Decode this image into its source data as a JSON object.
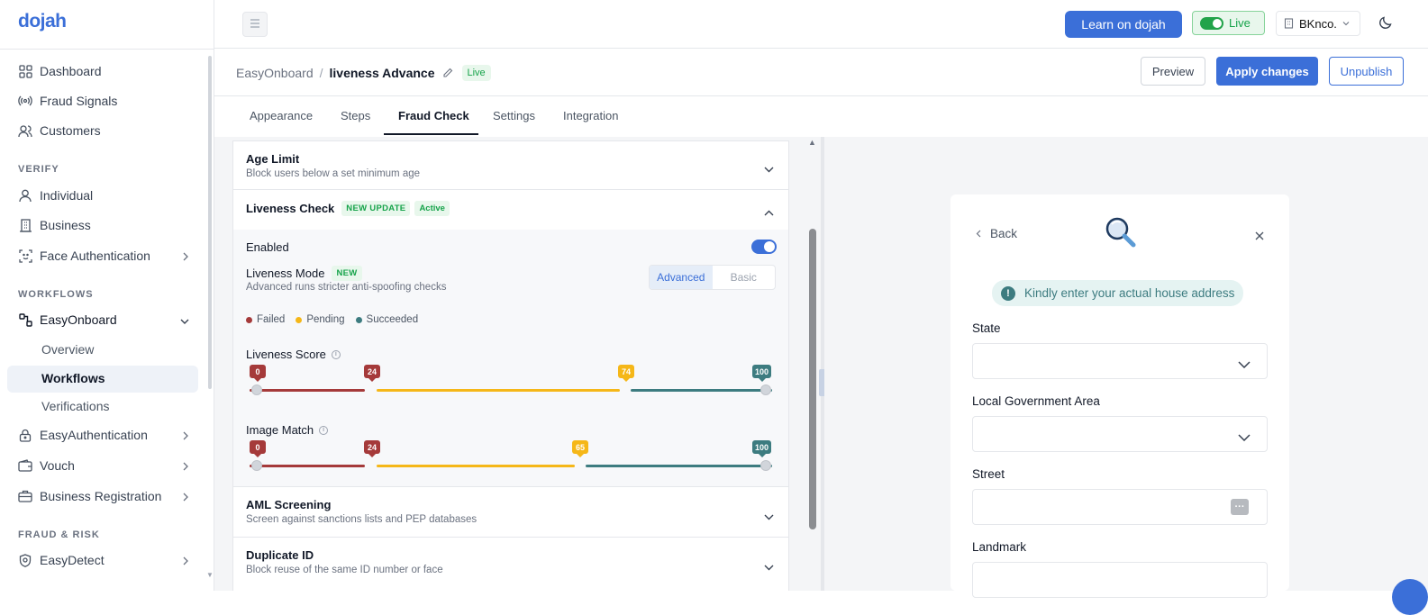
{
  "app": {
    "logo": "dojah"
  },
  "sidebar": {
    "items_top": [
      {
        "label": "Dashboard",
        "icon": "grid-icon"
      },
      {
        "label": "Fraud Signals",
        "icon": "signal-icon"
      },
      {
        "label": "Customers",
        "icon": "users-icon"
      }
    ],
    "section_verify": "VERIFY",
    "items_verify": [
      {
        "label": "Individual",
        "icon": "user-icon"
      },
      {
        "label": "Business",
        "icon": "building-icon"
      },
      {
        "label": "Face Authentication",
        "icon": "face-scan-icon"
      }
    ],
    "section_workflows": "WORKFLOWS",
    "easyonboard": "EasyOnboard",
    "sub_items": [
      "Overview",
      "Workflows",
      "Verifications"
    ],
    "items_workflows": [
      {
        "label": "EasyAuthentication",
        "icon": "lock-icon"
      },
      {
        "label": "Vouch",
        "icon": "wallet-icon"
      },
      {
        "label": "Business Registration",
        "icon": "briefcase-icon"
      }
    ],
    "section_fraud": "FRAUD & RISK",
    "easydetect": "EasyDetect"
  },
  "topbar": {
    "learn_label": "Learn on dojah",
    "live_label": "Live",
    "org_label": "BKnco."
  },
  "header": {
    "breadcrumb_root": "EasyOnboard",
    "breadcrumb_sep": "/",
    "breadcrumb_current": "liveness Advance",
    "status_badge": "Live",
    "preview_label": "Preview",
    "apply_label": "Apply changes",
    "unpublish_label": "Unpublish"
  },
  "tabs": [
    "Appearance",
    "Steps",
    "Fraud Check",
    "Settings",
    "Integration"
  ],
  "fraud_check": {
    "age_limit": {
      "title": "Age Limit",
      "subtitle": "Block users below a set minimum age"
    },
    "liveness": {
      "title": "Liveness Check",
      "badge_new": "NEW UPDATE",
      "badge_active": "Active",
      "enabled_label": "Enabled",
      "mode_label": "Liveness Mode",
      "mode_badge": "NEW",
      "mode_desc": "Advanced runs stricter anti-spoofing checks",
      "mode_options": [
        "Advanced",
        "Basic"
      ],
      "mode_selected": "Advanced",
      "legend": [
        {
          "label": "Failed",
          "color": "#a53a3a"
        },
        {
          "label": "Pending",
          "color": "#f5b718"
        },
        {
          "label": "Succeeded",
          "color": "#3d7c80"
        }
      ],
      "score_label": "Liveness Score",
      "score_thresholds": [
        "0",
        "24",
        "74",
        "100"
      ],
      "match_label": "Image Match",
      "match_thresholds": [
        "0",
        "24",
        "65",
        "100"
      ]
    },
    "aml": {
      "title": "AML Screening",
      "subtitle": "Screen against sanctions lists and PEP databases"
    },
    "duplicate": {
      "title": "Duplicate ID",
      "subtitle": "Block reuse of the same ID number or face"
    }
  },
  "preview": {
    "back_label": "Back",
    "alert": "Kindly enter your actual house address",
    "fields": [
      "State",
      "Local Government Area",
      "Street",
      "Landmark"
    ]
  }
}
